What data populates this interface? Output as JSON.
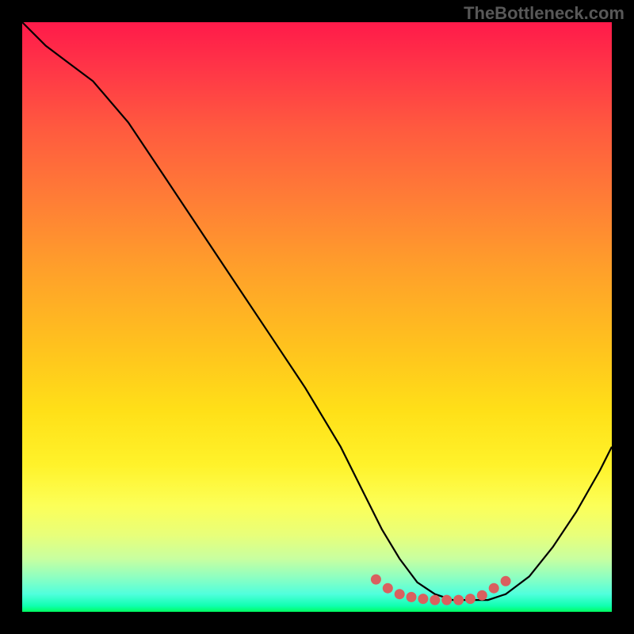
{
  "watermark": "TheBottleneck.com",
  "colors": {
    "background": "#000000",
    "curve": "#000000",
    "marker": "#d9605f",
    "watermark_text": "#585858"
  },
  "chart_data": {
    "type": "line",
    "title": "",
    "xlabel": "",
    "ylabel": "",
    "xlim": [
      0,
      100
    ],
    "ylim": [
      0,
      100
    ],
    "series": [
      {
        "name": "bottleneck-curve",
        "x": [
          0,
          4,
          8,
          12,
          18,
          24,
          30,
          36,
          42,
          48,
          54,
          58,
          61,
          64,
          67,
          70,
          73,
          76,
          79,
          82,
          86,
          90,
          94,
          98,
          100
        ],
        "y": [
          100,
          96,
          93,
          90,
          83,
          74,
          65,
          56,
          47,
          38,
          28,
          20,
          14,
          9,
          5,
          3,
          2,
          2,
          2,
          3,
          6,
          11,
          17,
          24,
          28
        ]
      }
    ],
    "markers": {
      "name": "highlighted-optimal-range",
      "color": "#d9605f",
      "points": [
        {
          "x": 60,
          "y": 5.5
        },
        {
          "x": 62,
          "y": 4.0
        },
        {
          "x": 64,
          "y": 3.0
        },
        {
          "x": 66,
          "y": 2.5
        },
        {
          "x": 68,
          "y": 2.2
        },
        {
          "x": 70,
          "y": 2.0
        },
        {
          "x": 72,
          "y": 2.0
        },
        {
          "x": 74,
          "y": 2.0
        },
        {
          "x": 76,
          "y": 2.2
        },
        {
          "x": 78,
          "y": 2.8
        },
        {
          "x": 80,
          "y": 4.0
        },
        {
          "x": 82,
          "y": 5.2
        }
      ]
    },
    "annotations": []
  }
}
